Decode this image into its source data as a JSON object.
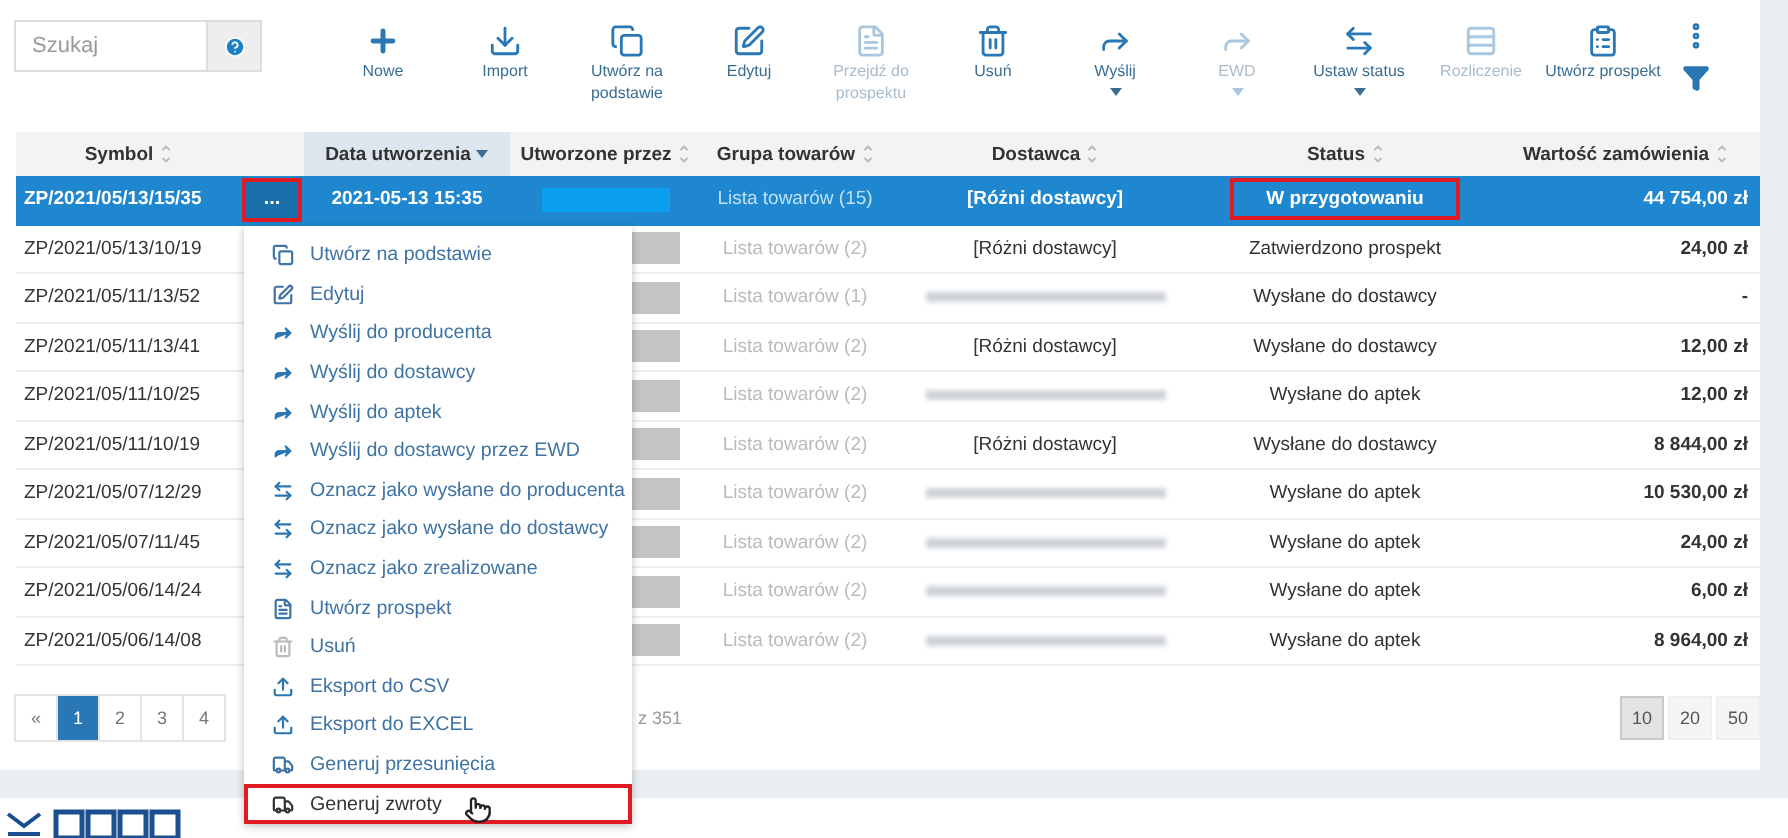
{
  "search": {
    "placeholder": "Szukaj"
  },
  "toolbar": [
    {
      "label": "Nowe",
      "disabled": false,
      "dropdown": false
    },
    {
      "label": "Import",
      "disabled": false,
      "dropdown": false
    },
    {
      "label": "Utwórz na podstawie",
      "disabled": false,
      "dropdown": false
    },
    {
      "label": "Edytuj",
      "disabled": false,
      "dropdown": false
    },
    {
      "label": "Przejdź do prospektu",
      "disabled": true,
      "dropdown": false
    },
    {
      "label": "Usuń",
      "disabled": false,
      "dropdown": false
    },
    {
      "label": "Wyślij",
      "disabled": false,
      "dropdown": true
    },
    {
      "label": "EWD",
      "disabled": true,
      "dropdown": true
    },
    {
      "label": "Ustaw status",
      "disabled": false,
      "dropdown": true
    },
    {
      "label": "Rozliczenie",
      "disabled": true,
      "dropdown": false
    },
    {
      "label": "Utwórz prospekt",
      "disabled": false,
      "dropdown": false
    }
  ],
  "table": {
    "columns": [
      {
        "label": "Symbol",
        "sorted": false
      },
      {
        "label": "Data utworzenia",
        "sorted": true
      },
      {
        "label": "Utworzone przez",
        "sorted": false
      },
      {
        "label": "Grupa towarów",
        "sorted": false
      },
      {
        "label": "Dostawca",
        "sorted": false
      },
      {
        "label": "Status",
        "sorted": false
      },
      {
        "label": "Wartość zamówienia",
        "sorted": false
      }
    ],
    "rows": [
      {
        "symbol": "ZP/2021/05/13/15/35",
        "selected": true,
        "actions": "...",
        "actions_highlighted": true,
        "date": "2021-05-13 15:35",
        "group": "Lista towarów (15)",
        "supplier": "[Różni dostawcy]",
        "status": "W przygotowaniu",
        "status_highlighted": true,
        "value": "44 754,00 zł"
      },
      {
        "symbol": "ZP/2021/05/13/10/19",
        "selected": false,
        "group": "Lista towarów (2)",
        "supplier": "[Różni dostawcy]",
        "status": "Zatwierdzono prospekt",
        "value": "24,00 zł"
      },
      {
        "symbol": "ZP/2021/05/11/13/52",
        "selected": false,
        "group": "Lista towarów (1)",
        "supplier_redacted": true,
        "status": "Wysłane do dostawcy",
        "value": "-"
      },
      {
        "symbol": "ZP/2021/05/11/13/41",
        "selected": false,
        "group": "Lista towarów (2)",
        "supplier": "[Różni dostawcy]",
        "status": "Wysłane do dostawcy",
        "value": "12,00 zł"
      },
      {
        "symbol": "ZP/2021/05/11/10/25",
        "selected": false,
        "group": "Lista towarów (2)",
        "supplier_redacted": true,
        "status": "Wysłane do aptek",
        "value": "12,00 zł"
      },
      {
        "symbol": "ZP/2021/05/11/10/19",
        "selected": false,
        "group": "Lista towarów (2)",
        "supplier": "[Różni dostawcy]",
        "status": "Wysłane do dostawcy",
        "value": "8 844,00 zł"
      },
      {
        "symbol": "ZP/2021/05/07/12/29",
        "selected": false,
        "group": "Lista towarów (2)",
        "supplier_redacted": true,
        "status": "Wysłane do aptek",
        "value": "10 530,00 zł"
      },
      {
        "symbol": "ZP/2021/05/07/11/45",
        "selected": false,
        "group": "Lista towarów (2)",
        "supplier_redacted": true,
        "status": "Wysłane do aptek",
        "value": "24,00 zł"
      },
      {
        "symbol": "ZP/2021/05/06/14/24",
        "selected": false,
        "group": "Lista towarów (2)",
        "supplier_redacted": true,
        "status": "Wysłane do aptek",
        "value": "6,00 zł"
      },
      {
        "symbol": "ZP/2021/05/06/14/08",
        "selected": false,
        "group": "Lista towarów (2)",
        "supplier_redacted": true,
        "status": "Wysłane do aptek",
        "value": "8 964,00 zł"
      }
    ]
  },
  "pagination": {
    "pages": [
      {
        "label": "«",
        "selected": false
      },
      {
        "label": "1",
        "selected": true
      },
      {
        "label": "2",
        "selected": false
      },
      {
        "label": "3",
        "selected": false
      },
      {
        "label": "4",
        "selected": false
      }
    ],
    "info": "z 351",
    "sizes": [
      {
        "label": "10",
        "selected": true
      },
      {
        "label": "20",
        "selected": false
      },
      {
        "label": "50",
        "selected": false
      }
    ]
  },
  "context_menu": [
    {
      "label": "Utwórz na podstawie",
      "kind": "copy",
      "highlighted": false
    },
    {
      "label": "Edytuj",
      "kind": "edit",
      "highlighted": false
    },
    {
      "label": "Wyślij do producenta",
      "kind": "send",
      "highlighted": false
    },
    {
      "label": "Wyślij do dostawcy",
      "kind": "send",
      "highlighted": false
    },
    {
      "label": "Wyślij do aptek",
      "kind": "send",
      "highlighted": false
    },
    {
      "label": "Wyślij do dostawcy przez EWD",
      "kind": "send",
      "highlighted": false
    },
    {
      "label": "Oznacz jako wysłane do producenta",
      "kind": "swap",
      "highlighted": false
    },
    {
      "label": "Oznacz jako wysłane do dostawcy",
      "kind": "swap",
      "highlighted": false
    },
    {
      "label": "Oznacz jako zrealizowane",
      "kind": "swap",
      "highlighted": false
    },
    {
      "label": "Utwórz prospekt",
      "kind": "document",
      "highlighted": false
    },
    {
      "label": "Usuń",
      "kind": "trash",
      "highlighted": false
    },
    {
      "label": "Eksport do CSV",
      "kind": "export",
      "highlighted": false
    },
    {
      "label": "Eksport do EXCEL",
      "kind": "export",
      "highlighted": false
    },
    {
      "label": "Generuj przesunięcia",
      "kind": "transfer",
      "highlighted": false
    },
    {
      "label": "Generuj zwroty",
      "kind": "transfer",
      "highlighted": true
    }
  ]
}
